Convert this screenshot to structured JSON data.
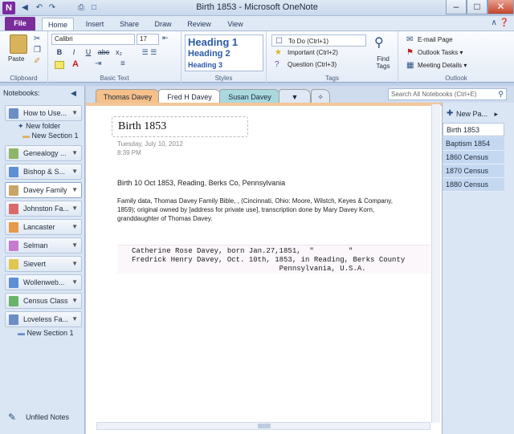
{
  "app": {
    "title": "Birth 1853 - Microsoft OneNote",
    "icon_letter": "N",
    "qa_icons": [
      "back-icon",
      "undo-icon",
      "redo-icon",
      "print-icon",
      "dock-icon"
    ]
  },
  "ribbon": {
    "file_tab": "File",
    "tabs": [
      "Home",
      "Insert",
      "Share",
      "Draw",
      "Review",
      "View"
    ],
    "active_tab": "Home",
    "clipboard": {
      "paste_label": "Paste",
      "group_label": "Clipboard"
    },
    "basic_text": {
      "font": "Calibri",
      "size": "17",
      "bold": "B",
      "italic": "I",
      "underline": "U",
      "strike": "abc",
      "subscript": "x₂",
      "group_label": "Basic Text"
    },
    "styles": {
      "items": [
        "Heading 1",
        "Heading 2",
        "Heading 3"
      ],
      "group_label": "Styles"
    },
    "tags": {
      "items": [
        "To Do (Ctrl+1)",
        "Important (Ctrl+2)",
        "Question (Ctrl+3)"
      ],
      "find_tags": "Find Tags",
      "group_label": "Tags"
    },
    "outlook": {
      "items": [
        "E-mail Page",
        "Outlook Tasks ▾",
        "Meeting Details ▾"
      ],
      "group_label": "Outlook"
    }
  },
  "notebooks": {
    "header": "Notebooks:",
    "items": [
      {
        "label": "How to Use...",
        "color": "#6b8ec4"
      },
      {
        "label": "Genealogy ...",
        "color": "#8fb56a"
      },
      {
        "label": "Bishop & S...",
        "color": "#5c8fd4"
      },
      {
        "label": "Davey Family",
        "color": "#c9a56a"
      },
      {
        "label": "Johnston Fa...",
        "color": "#d86a6a"
      },
      {
        "label": "Lancaster",
        "color": "#e39a4a"
      },
      {
        "label": "Selman",
        "color": "#c67ad0"
      },
      {
        "label": "Sievert",
        "color": "#e0c850"
      },
      {
        "label": "Wollenweb...",
        "color": "#5c8fd4"
      },
      {
        "label": "Census Class",
        "color": "#6ab46a"
      },
      {
        "label": "Loveless Fa...",
        "color": "#6b8ec4"
      }
    ],
    "sub_items": [
      "New folder",
      "New Section 1",
      "New Section 1"
    ],
    "unfiled": "Unfiled Notes"
  },
  "sections": {
    "tabs": [
      {
        "label": "Thomas Davey",
        "color": "#f5c08a"
      },
      {
        "label": "Fred H Davey",
        "color": "#ffffff"
      },
      {
        "label": "Susan Davey",
        "color": "#a9d8df"
      }
    ],
    "search_placeholder": "Search All Notebooks (Ctrl+E)"
  },
  "page": {
    "title": "Birth 1853",
    "date": "Tuesday, July 10, 2012",
    "time": "8:39 PM",
    "line1": "Birth 10 Oct 1853, Reading, Berks Co, Pennsylvania",
    "paragraph": "Family data, Thomas Davey Family Bible, , (Cincinnati, Ohio: Moore, Wilstch, Keyes & Company, 1859); original owned by [address for private use], transcription done by Mary Davey Korn, granddaughter of Thomas Davey.",
    "scan_lines": [
      "Catherine Rose Davey, born Jan.27,1851,  \"        \"",
      "Fredrick Henry Davey, Oct. 10th, 1853, in Reading, Berks County",
      "                                  Pennsylvania, U.S.A."
    ]
  },
  "pages": {
    "new_page": "New Pa...",
    "items": [
      "Birth 1853",
      "Baptism 1854",
      "1860 Census",
      "1870 Census",
      "1880 Census"
    ]
  }
}
